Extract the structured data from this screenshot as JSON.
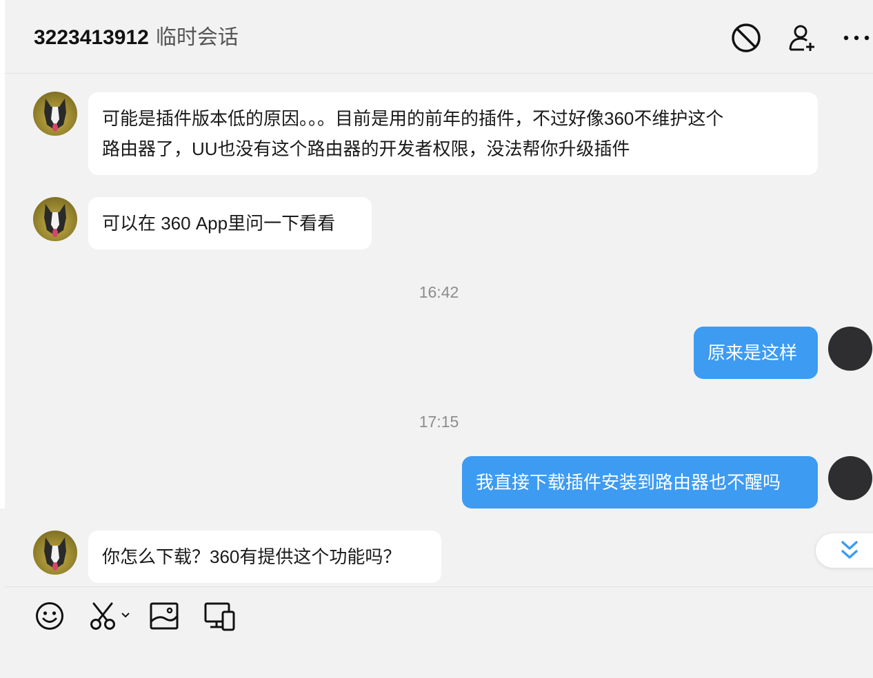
{
  "header": {
    "contact_id": "3223413912",
    "session_type": "临时会话",
    "icons": [
      "block-icon",
      "add-friend-icon",
      "more-icon"
    ]
  },
  "messages": [
    {
      "type": "incoming",
      "text_line1": "可能是插件版本低的原因。。。目前是用的前年的插件，不过好像360不维护这个",
      "text_line2": "路由器了，UU也没有这个路由器的开发者权限，没法帮你升级插件"
    },
    {
      "type": "incoming",
      "text": "可以在 360 App里问一下看看"
    },
    {
      "type": "time",
      "text": "16:42"
    },
    {
      "type": "outgoing",
      "text": "原来是这样"
    },
    {
      "type": "time",
      "text": "17:15"
    },
    {
      "type": "outgoing",
      "text": "我直接下载插件安装到路由器也不醒吗"
    },
    {
      "type": "incoming",
      "text": "你怎么下载？360有提供这个功能吗？"
    }
  ],
  "toolbar": {
    "icons": [
      "emoji-icon",
      "screenshot-scissors-icon",
      "image-icon",
      "screen-share-icon"
    ]
  },
  "colors": {
    "background": "#f2f2f2",
    "outgoing_bubble": "#3d9bf2",
    "incoming_bubble": "#ffffff",
    "scroll_arrow": "#3d9bf2"
  }
}
